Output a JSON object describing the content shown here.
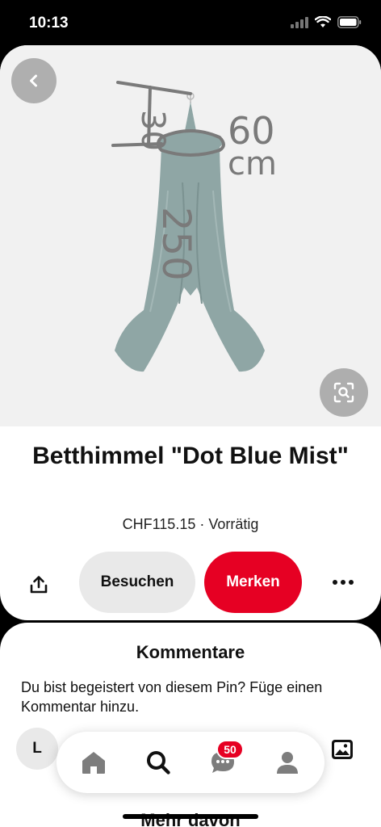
{
  "status_bar": {
    "time": "10:13",
    "icons": [
      "cellular-signal-icon",
      "wifi-icon",
      "battery-icon"
    ]
  },
  "pin": {
    "image_annotations": {
      "height_top": "30",
      "width": "60",
      "width_unit": "cm",
      "length": "250"
    },
    "title": "Betthimmel \"Dot Blue Mist\"",
    "meta": "CHF115.15 · Vorrätig",
    "buttons": {
      "visit": "Besuchen",
      "save": "Merken"
    },
    "icons": {
      "back": "chevron-left-icon",
      "lens": "visual-search-icon",
      "share": "share-icon",
      "more": "more-dots-icon"
    }
  },
  "comments": {
    "title": "Kommentare",
    "prompt": "Du bist begeistert von diesem Pin? Füge einen Kommentar hinzu.",
    "avatar_letter": "L",
    "more_from": "Mehr davon"
  },
  "nav": {
    "items": [
      "home-icon",
      "search-icon",
      "messages-icon",
      "profile-icon"
    ],
    "messages_badge": "50"
  },
  "colors": {
    "accent": "#e60023",
    "canopy": "#8fa6a5",
    "scribble": "#7a7a7a"
  }
}
